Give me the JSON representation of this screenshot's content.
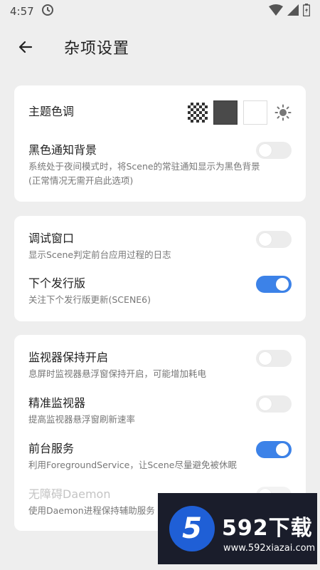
{
  "status_bar": {
    "time": "4:57"
  },
  "app_bar": {
    "title": "杂项设置"
  },
  "card_theme": {
    "theme": {
      "title": "主题色调",
      "swatches": [
        "pattern",
        "dark",
        "light"
      ],
      "mode_icon": "sun-icon"
    },
    "black_notification": {
      "title": "黑色通知背景",
      "desc_1": "系统处于夜间模式时，将Scene的常驻通知显示为黑色背景",
      "desc_2": "(正常情况无需开启此选项)",
      "enabled": false
    }
  },
  "card_debug": {
    "debug_window": {
      "title": "调试窗口",
      "desc": "显示Scene判定前台应用过程的日志",
      "enabled": false
    },
    "next_release": {
      "title": "下个发行版",
      "desc": "关注下个发行版更新(SCENE6)",
      "enabled": true
    }
  },
  "card_monitor": {
    "monitor_keep_on": {
      "title": "监视器保持开启",
      "desc": "息屏时监视器悬浮窗保持开启，可能增加耗电",
      "enabled": false
    },
    "precise_monitor": {
      "title": "精准监视器",
      "desc": "提高监视器悬浮窗刷新速率",
      "enabled": false
    },
    "foreground_service": {
      "title": "前台服务",
      "desc": "利用ForegroundService，让Scene尽量避免被休眠",
      "enabled": true
    },
    "accessibility_daemon": {
      "title": "无障碍Daemon",
      "desc": "使用Daemon进程保持辅助服务",
      "enabled": false
    }
  },
  "watermark": {
    "badge": "5",
    "brand": "592下载",
    "url": "www.592xiazai.com"
  },
  "colors": {
    "accent": "#3c82e8",
    "background": "#eeeeee",
    "card": "#ffffff"
  }
}
